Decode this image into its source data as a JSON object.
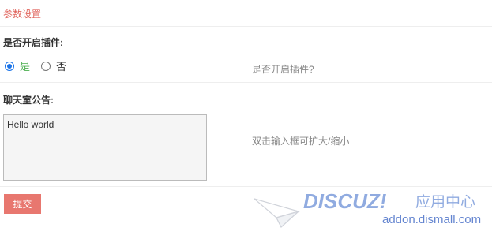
{
  "section": {
    "title": "参数设置"
  },
  "plugin_toggle": {
    "label": "是否开启插件:",
    "options": [
      "是",
      "否"
    ],
    "selected": "是",
    "hint": "是否开启插件?"
  },
  "announcement": {
    "label": "聊天室公告:",
    "value": "Hello world",
    "hint": "双击输入框可扩大/缩小"
  },
  "form": {
    "submit_label": "提交"
  },
  "watermark": {
    "brand": "DISCUZ!",
    "subtitle": "应用中心",
    "url": "addon.dismall.com"
  },
  "colors": {
    "accent": "#e8776f",
    "title_red": "#e0645c",
    "radio_blue": "#1a73e8",
    "selected_green": "#4caf50",
    "watermark_blue": "#6c8fd6"
  }
}
